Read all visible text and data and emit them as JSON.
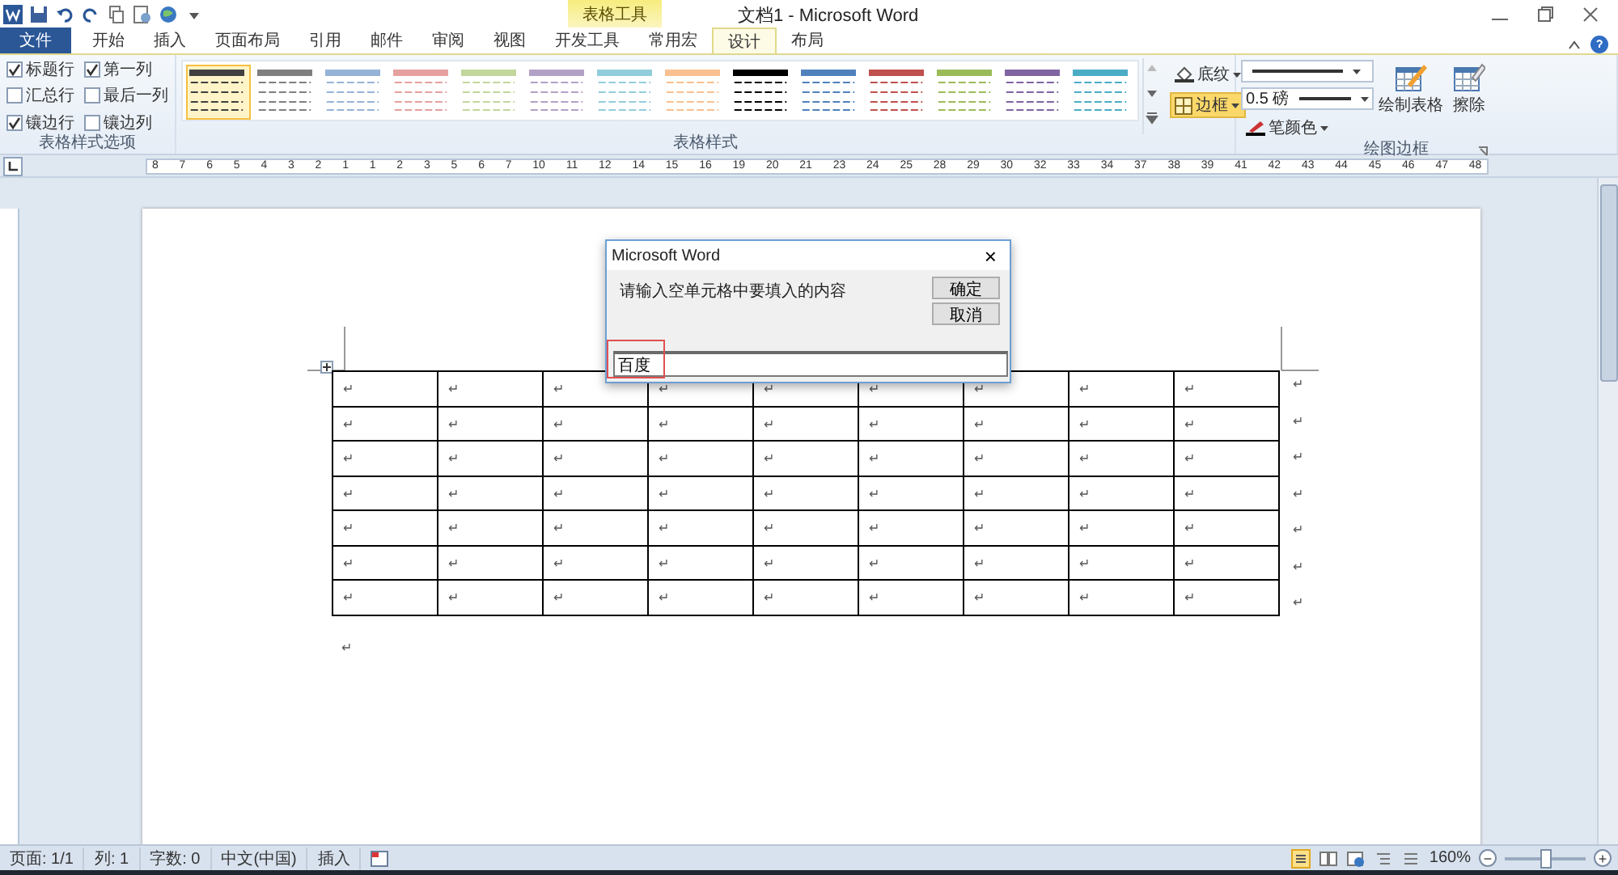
{
  "window": {
    "title": "文档1 - Microsoft Word",
    "context_tab": "表格工具"
  },
  "tabs": [
    {
      "label": "文件",
      "kind": "file",
      "selected": false
    },
    {
      "label": "开始",
      "kind": "tab",
      "selected": false
    },
    {
      "label": "插入",
      "kind": "tab",
      "selected": false
    },
    {
      "label": "页面布局",
      "kind": "tab",
      "selected": false
    },
    {
      "label": "引用",
      "kind": "tab",
      "selected": false
    },
    {
      "label": "邮件",
      "kind": "tab",
      "selected": false
    },
    {
      "label": "审阅",
      "kind": "tab",
      "selected": false
    },
    {
      "label": "视图",
      "kind": "tab",
      "selected": false
    },
    {
      "label": "开发工具",
      "kind": "tab",
      "selected": false
    },
    {
      "label": "常用宏",
      "kind": "tab",
      "selected": false
    },
    {
      "label": "设计",
      "kind": "context",
      "selected": true
    },
    {
      "label": "布局",
      "kind": "context",
      "selected": false
    }
  ],
  "style_options": {
    "label": "表格样式选项",
    "items": [
      {
        "label": "标题行",
        "checked": true
      },
      {
        "label": "第一列",
        "checked": true
      },
      {
        "label": "汇总行",
        "checked": false
      },
      {
        "label": "最后一列",
        "checked": false
      },
      {
        "label": "镶边行",
        "checked": true
      },
      {
        "label": "镶边列",
        "checked": false
      }
    ]
  },
  "table_styles": {
    "label": "表格样式",
    "items": [
      {
        "color": "#404040",
        "selected": true
      },
      {
        "color": "#7f7f7f",
        "selected": false
      },
      {
        "color": "#95b3d7",
        "selected": false
      },
      {
        "color": "#e6a0a0",
        "selected": false
      },
      {
        "color": "#c3d69b",
        "selected": false
      },
      {
        "color": "#b2a1c7",
        "selected": false
      },
      {
        "color": "#92cddc",
        "selected": false
      },
      {
        "color": "#fac090",
        "selected": false
      },
      {
        "color": "#000000",
        "selected": false
      },
      {
        "color": "#4f81bd",
        "selected": false
      },
      {
        "color": "#c0504d",
        "selected": false
      },
      {
        "color": "#9bbb59",
        "selected": false
      },
      {
        "color": "#8064a2",
        "selected": false
      },
      {
        "color": "#4bacc6",
        "selected": false
      }
    ]
  },
  "borders": {
    "label": "绘图边框",
    "shading": "底纹",
    "border": "边框",
    "border_active": true,
    "weight": "0.5 磅",
    "pen_color": "笔颜色",
    "draw_table": "绘制表格",
    "eraser": "擦除"
  },
  "ruler": [
    "8",
    "7",
    "6",
    "5",
    "4",
    "3",
    "2",
    "1",
    "1",
    "2",
    "3",
    "5",
    "6",
    "7",
    "10",
    "11",
    "12",
    "14",
    "15",
    "16",
    "19",
    "20",
    "21",
    "23",
    "24",
    "25",
    "28",
    "29",
    "30",
    "32",
    "33",
    "34",
    "37",
    "38",
    "39",
    "41",
    "42",
    "43",
    "44",
    "45",
    "46",
    "47",
    "48"
  ],
  "table": {
    "rows": [
      {
        "cells": [
          "↵",
          "↵",
          "↵",
          "↵",
          "↵",
          "↵",
          "↵",
          "↵",
          "↵"
        ],
        "end": "↵"
      },
      {
        "cells": [
          "↵",
          "↵",
          "↵",
          "↵",
          "↵",
          "↵",
          "↵",
          "↵",
          "↵"
        ],
        "end": "↵"
      },
      {
        "cells": [
          "↵",
          "↵",
          "↵",
          "↵",
          "↵",
          "↵",
          "↵",
          "↵",
          "↵"
        ],
        "end": "↵"
      },
      {
        "cells": [
          "↵",
          "↵",
          "↵",
          "↵",
          "↵",
          "↵",
          "↵",
          "↵",
          "↵"
        ],
        "end": "↵"
      },
      {
        "cells": [
          "↵",
          "↵",
          "↵",
          "↵",
          "↵",
          "↵",
          "↵",
          "↵",
          "↵"
        ],
        "end": "↵"
      },
      {
        "cells": [
          "↵",
          "↵",
          "↵",
          "↵",
          "↵",
          "↵",
          "↵",
          "↵",
          "↵"
        ],
        "end": "↵"
      },
      {
        "cells": [
          "↵",
          "↵",
          "↵",
          "↵",
          "↵",
          "↵",
          "↵",
          "↵",
          "↵"
        ],
        "end": "↵"
      }
    ],
    "after": "↵"
  },
  "dialog": {
    "title": "Microsoft Word",
    "close": "×",
    "message": "请输入空单元格中要填入的内容",
    "ok": "确定",
    "cancel": "取消",
    "value": "百度"
  },
  "status_bar": {
    "items": [
      "页面: 1/1",
      "列: 1",
      "字数: 0",
      "中文(中国)",
      "插入"
    ],
    "zoom": "160%",
    "zoom_out": "−",
    "zoom_in": "+",
    "zoom_level": {
      "level": 0.5
    }
  }
}
